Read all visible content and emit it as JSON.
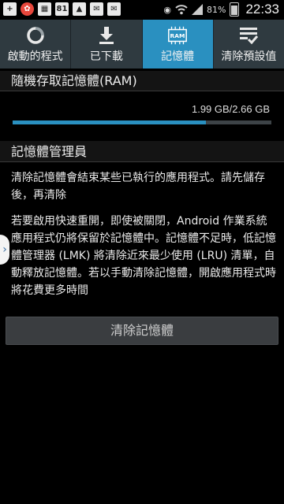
{
  "status_bar": {
    "time": "22:33",
    "battery": "81%",
    "notification_badge": "81",
    "icons": [
      "plus-icon",
      "pinwheel-app-icon",
      "gallery-icon",
      "gallery-check-icon",
      "mail-check-icon",
      "mail-icon",
      "eye-icon",
      "wifi-icon",
      "signal-icon",
      "battery-icon"
    ]
  },
  "tabs": [
    {
      "label": "啟動的程式",
      "icon": "running-apps-icon"
    },
    {
      "label": "已下載",
      "icon": "download-icon"
    },
    {
      "label": "記憶體",
      "icon": "ram-chip-icon",
      "icon_text": "RAM",
      "active": true
    },
    {
      "label": "清除預設值",
      "icon": "clear-defaults-icon"
    }
  ],
  "ram": {
    "title": "隨機存取記憶體(RAM)",
    "usage_text": "1.99 GB/2.66 GB",
    "used_fraction": 0.748
  },
  "memory_manager": {
    "title": "記憶體管理員",
    "paragraph1": "清除記憶體會結束某些已執行的應用程式。請先儲存後，再清除",
    "paragraph2": "若要啟用快速重開，即使被關閉，Android 作業系統應用程式仍將保留於記憶體中。記憶體不足時，低記憶體管理器 (LMK) 將清除近來最少使用 (LRU) 清單，自動釋放記憶體。若以手動清除記憶體，開啟應用程式時將花費更多時間",
    "clear_button": "清除記憶體"
  },
  "colors": {
    "accent": "#2a90c0",
    "tab_bg": "#2f3a40"
  }
}
